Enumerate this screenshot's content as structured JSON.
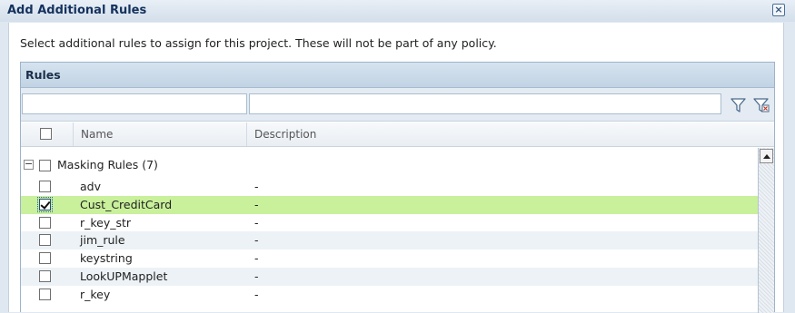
{
  "dialog": {
    "title": "Add Additional Rules",
    "instruction": "Select additional rules to assign for this project. These will not be part of any policy."
  },
  "panel": {
    "title": "Rules",
    "filters": {
      "name_value": "",
      "description_value": ""
    },
    "columns": {
      "name": "Name",
      "description": "Description"
    },
    "group": {
      "label": "Masking Rules (7)",
      "checked": false,
      "expanded": true
    },
    "rows": [
      {
        "name": "adv",
        "description": "-",
        "checked": false
      },
      {
        "name": "Cust_CreditCard",
        "description": "-",
        "checked": true
      },
      {
        "name": "r_key_str",
        "description": "-",
        "checked": false
      },
      {
        "name": "jim_rule",
        "description": "-",
        "checked": false
      },
      {
        "name": "keystring",
        "description": "-",
        "checked": false
      },
      {
        "name": "LookUPMapplet",
        "description": "-",
        "checked": false
      },
      {
        "name": "r_key",
        "description": "-",
        "checked": false
      }
    ]
  },
  "colors": {
    "selected_row": "#c9f09b",
    "alt_row": "#edf2f7",
    "header_bg": "#c1d3e4",
    "title_text": "#15325e"
  }
}
